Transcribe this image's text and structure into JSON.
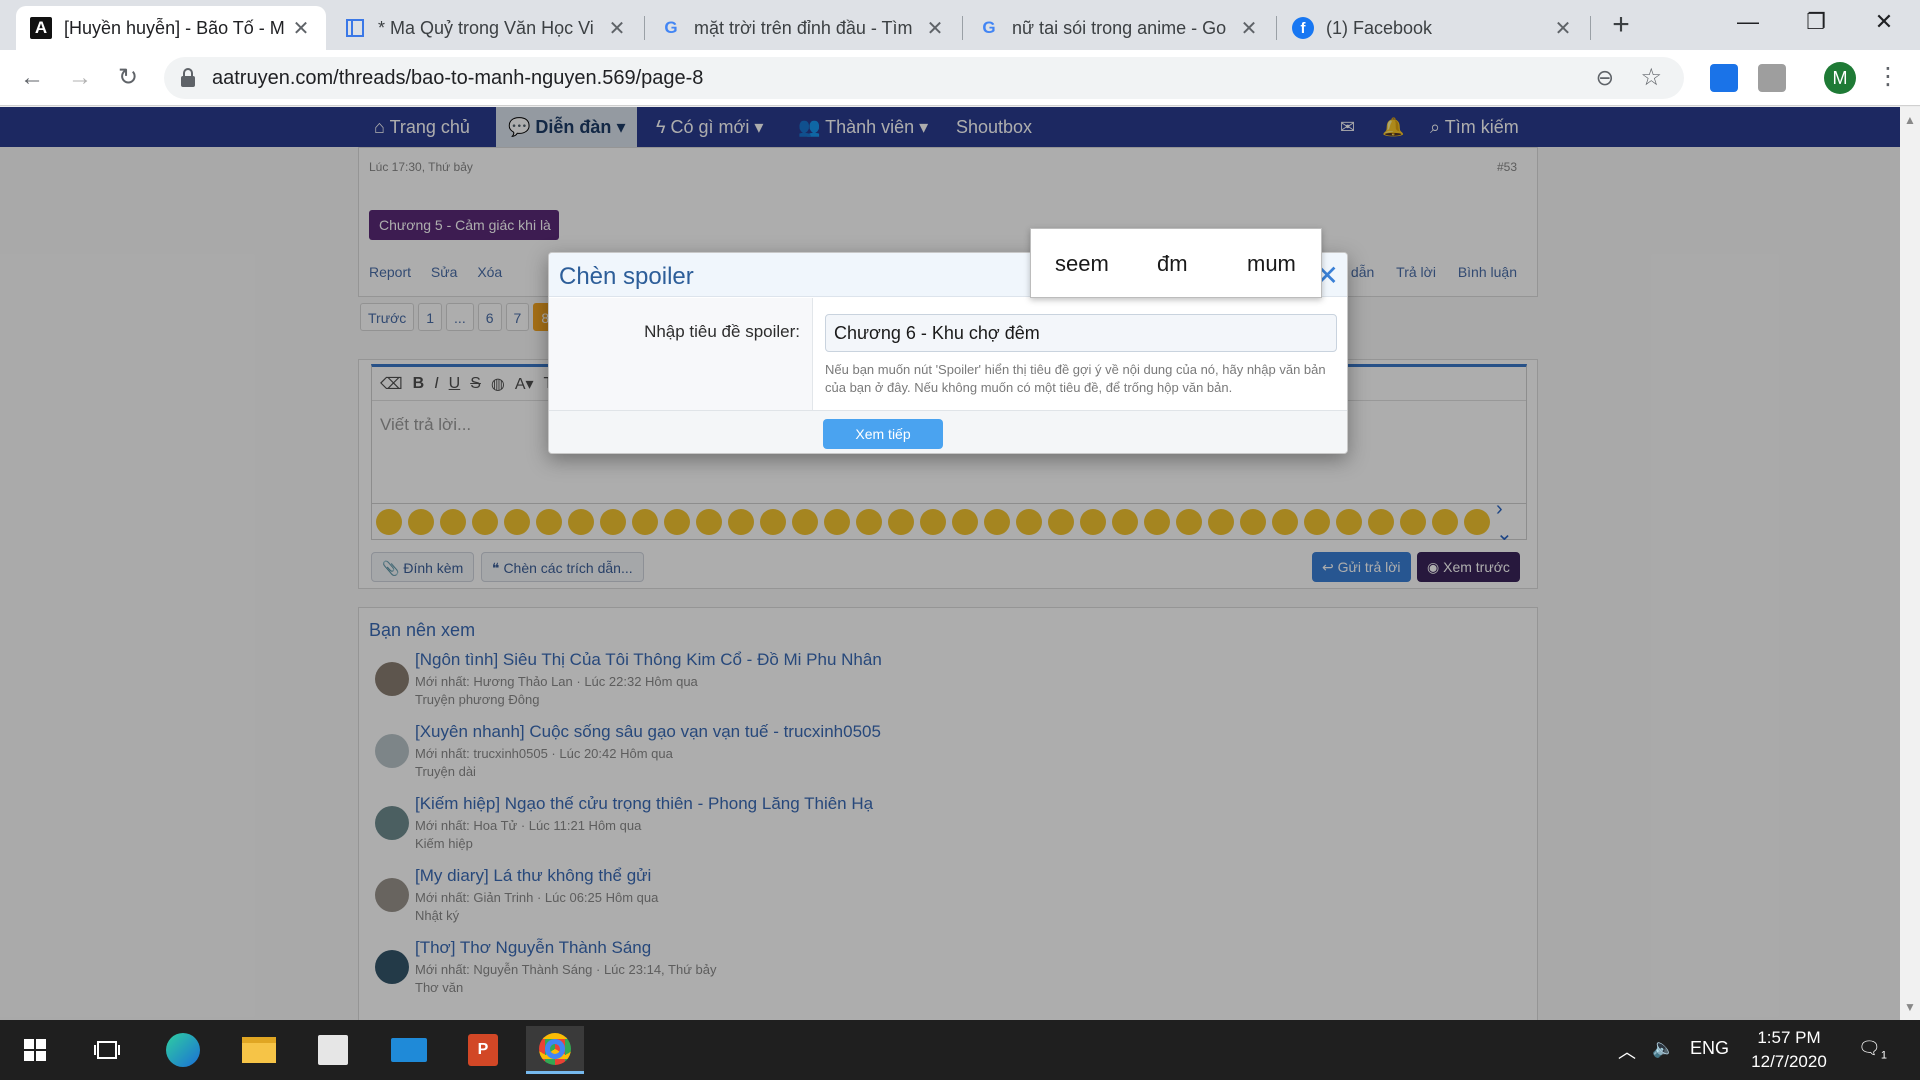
{
  "browser": {
    "tabs": [
      {
        "title": "[Huyền huyễn] - Bão Tố - M",
        "icon": "A",
        "active": true
      },
      {
        "title": "* Ma Quỷ trong Văn Học Vi",
        "icon": "doc",
        "active": false
      },
      {
        "title": "mặt trời trên đỉnh đầu - Tìm",
        "icon": "G",
        "active": false
      },
      {
        "title": "nữ tai sói trong anime - Go",
        "icon": "G",
        "active": false
      },
      {
        "title": "(1) Facebook",
        "icon": "f",
        "active": false
      }
    ],
    "url": "aatruyen.com/threads/bao-to-manh-nguyen.569/page-8",
    "profile_initial": "M"
  },
  "site": {
    "nav": [
      "Trang chủ",
      "Diễn đàn",
      "Có gì mới",
      "Thành viên",
      "Shoutbox"
    ],
    "search": "Tìm kiếm"
  },
  "post": {
    "meta": "Lúc 17:30, Thứ bảy",
    "number": "#53",
    "tag": "Chương 5 - Cảm giác khi là",
    "actions": [
      "Report",
      "Sửa",
      "Xóa"
    ],
    "right_actions": [
      "dẫn",
      "Trả lời",
      "Bình luận"
    ]
  },
  "pager": [
    "Trước",
    "1",
    "...",
    "6",
    "7",
    "8"
  ],
  "editor": {
    "placeholder": "Viết trả lời...",
    "attach": "Đính kèm",
    "quotes": "Chèn các trích dẫn...",
    "send": "Gửi trả lời",
    "preview": "Xem trước"
  },
  "related": {
    "heading": "Bạn nên xem",
    "items": [
      {
        "title": "[Ngôn tình] Siêu Thị Của Tôi Thông Kim Cổ - Đồ Mi Phu Nhân",
        "meta": "Mới nhất: Hương Thảo Lan · Lúc 22:32 Hôm qua",
        "cat": "Truyện phương Đông"
      },
      {
        "title": "[Xuyên nhanh] Cuộc sống sâu gạo vạn vạn tuế - trucxinh0505",
        "meta": "Mới nhất: trucxinh0505 · Lúc 20:42 Hôm qua",
        "cat": "Truyện dài"
      },
      {
        "title": "[Kiếm hiệp] Ngạo thế cửu trọng thiên - Phong Lăng Thiên Hạ",
        "meta": "Mới nhất: Hoa Tử · Lúc 11:21 Hôm qua",
        "cat": "Kiếm hiệp"
      },
      {
        "title": "[My diary] Lá thư không thể gửi",
        "meta": "Mới nhất: Giản Trinh · Lúc 06:25 Hôm qua",
        "cat": "Nhật ký"
      },
      {
        "title": "[Thơ] Thơ Nguyễn Thành Sáng",
        "meta": "Mới nhất: Nguyễn Thành Sáng · Lúc 23:14, Thứ bảy",
        "cat": "Thơ văn"
      }
    ]
  },
  "modal": {
    "title": "Chèn spoiler",
    "label": "Nhập tiêu đề spoiler:",
    "value": "Chương 6 - Khu chợ đêm",
    "hint": "Nếu bạn muốn nút 'Spoiler' hiển thị tiêu đề gợi ý về nội dung của nó, hãy nhập văn bản của bạn ở đây. Nếu không muốn có một tiêu đề, để trống hộp văn bản.",
    "next": "Xem tiếp"
  },
  "ime": [
    "seem",
    "đm",
    "mum"
  ],
  "taskbar": {
    "lang": "ENG",
    "time": "1:57 PM",
    "date": "12/7/2020",
    "notif_count": "1"
  },
  "colors": {
    "site_nav": "#2a3b8f",
    "accent": "#3a7fd6",
    "modal_title": "#2d5e99"
  }
}
